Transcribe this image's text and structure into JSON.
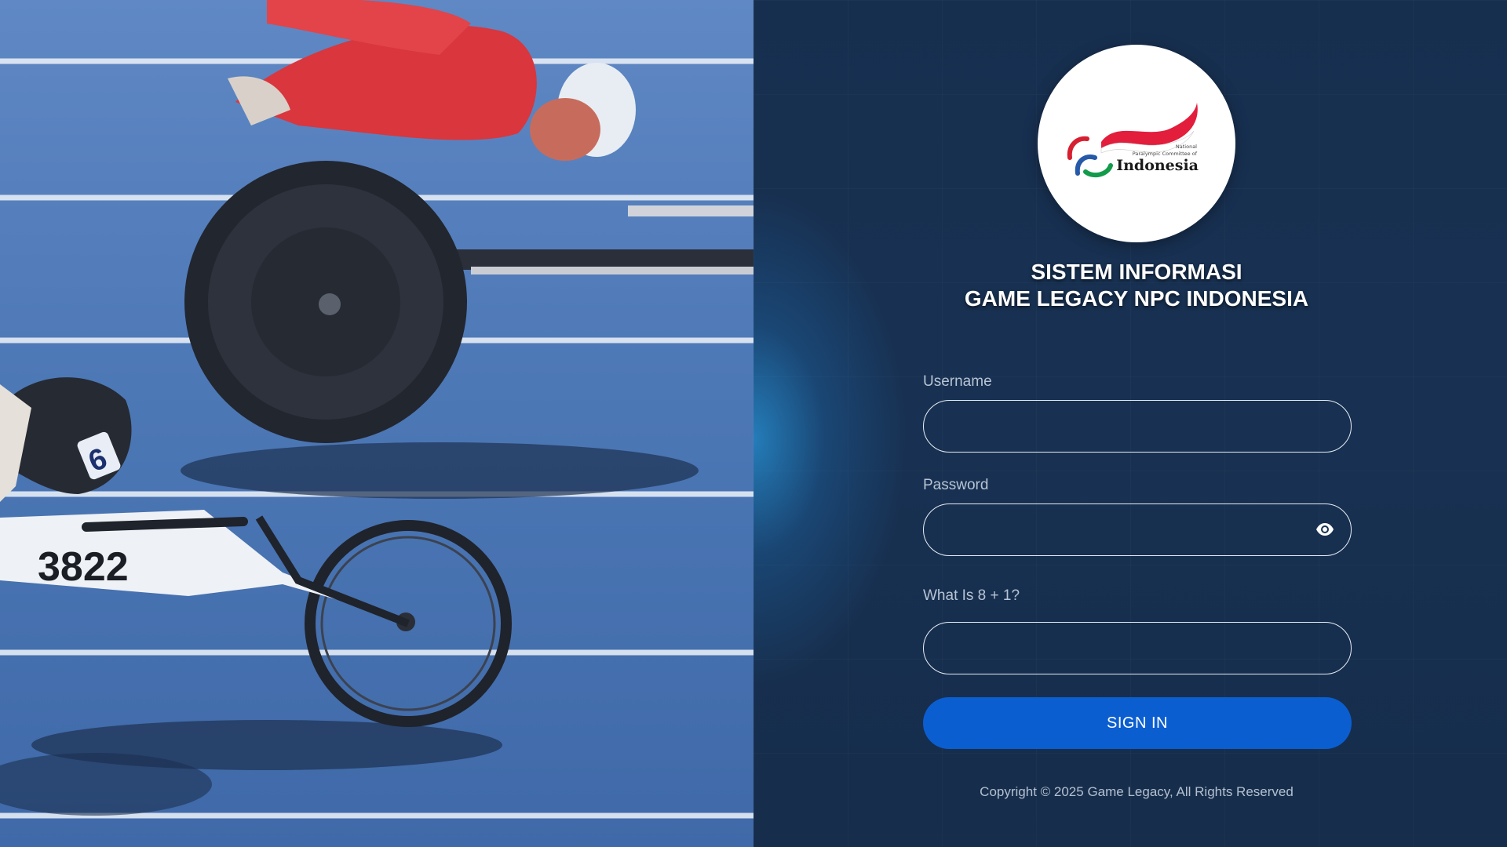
{
  "hero": {
    "bib_number": "3822"
  },
  "logo": {
    "line1": "National",
    "line2": "Paralympic Committee of",
    "line3": "Indonesia"
  },
  "title": {
    "line1": "SISTEM INFORMASI",
    "line2": "GAME LEGACY NPC INDONESIA"
  },
  "form": {
    "username_label": "Username",
    "username_value": "",
    "password_label": "Password",
    "password_value": "",
    "captcha_label": "What Is 8 + 1?",
    "captcha_value": "",
    "signin_label": "SIGN IN"
  },
  "footer": {
    "copyright": "Copyright © 2025 Game Legacy, All Rights Reserved"
  },
  "colors": {
    "panel_bg": "#17304f",
    "button": "#0b5ed0",
    "track": "#4d78b6"
  }
}
